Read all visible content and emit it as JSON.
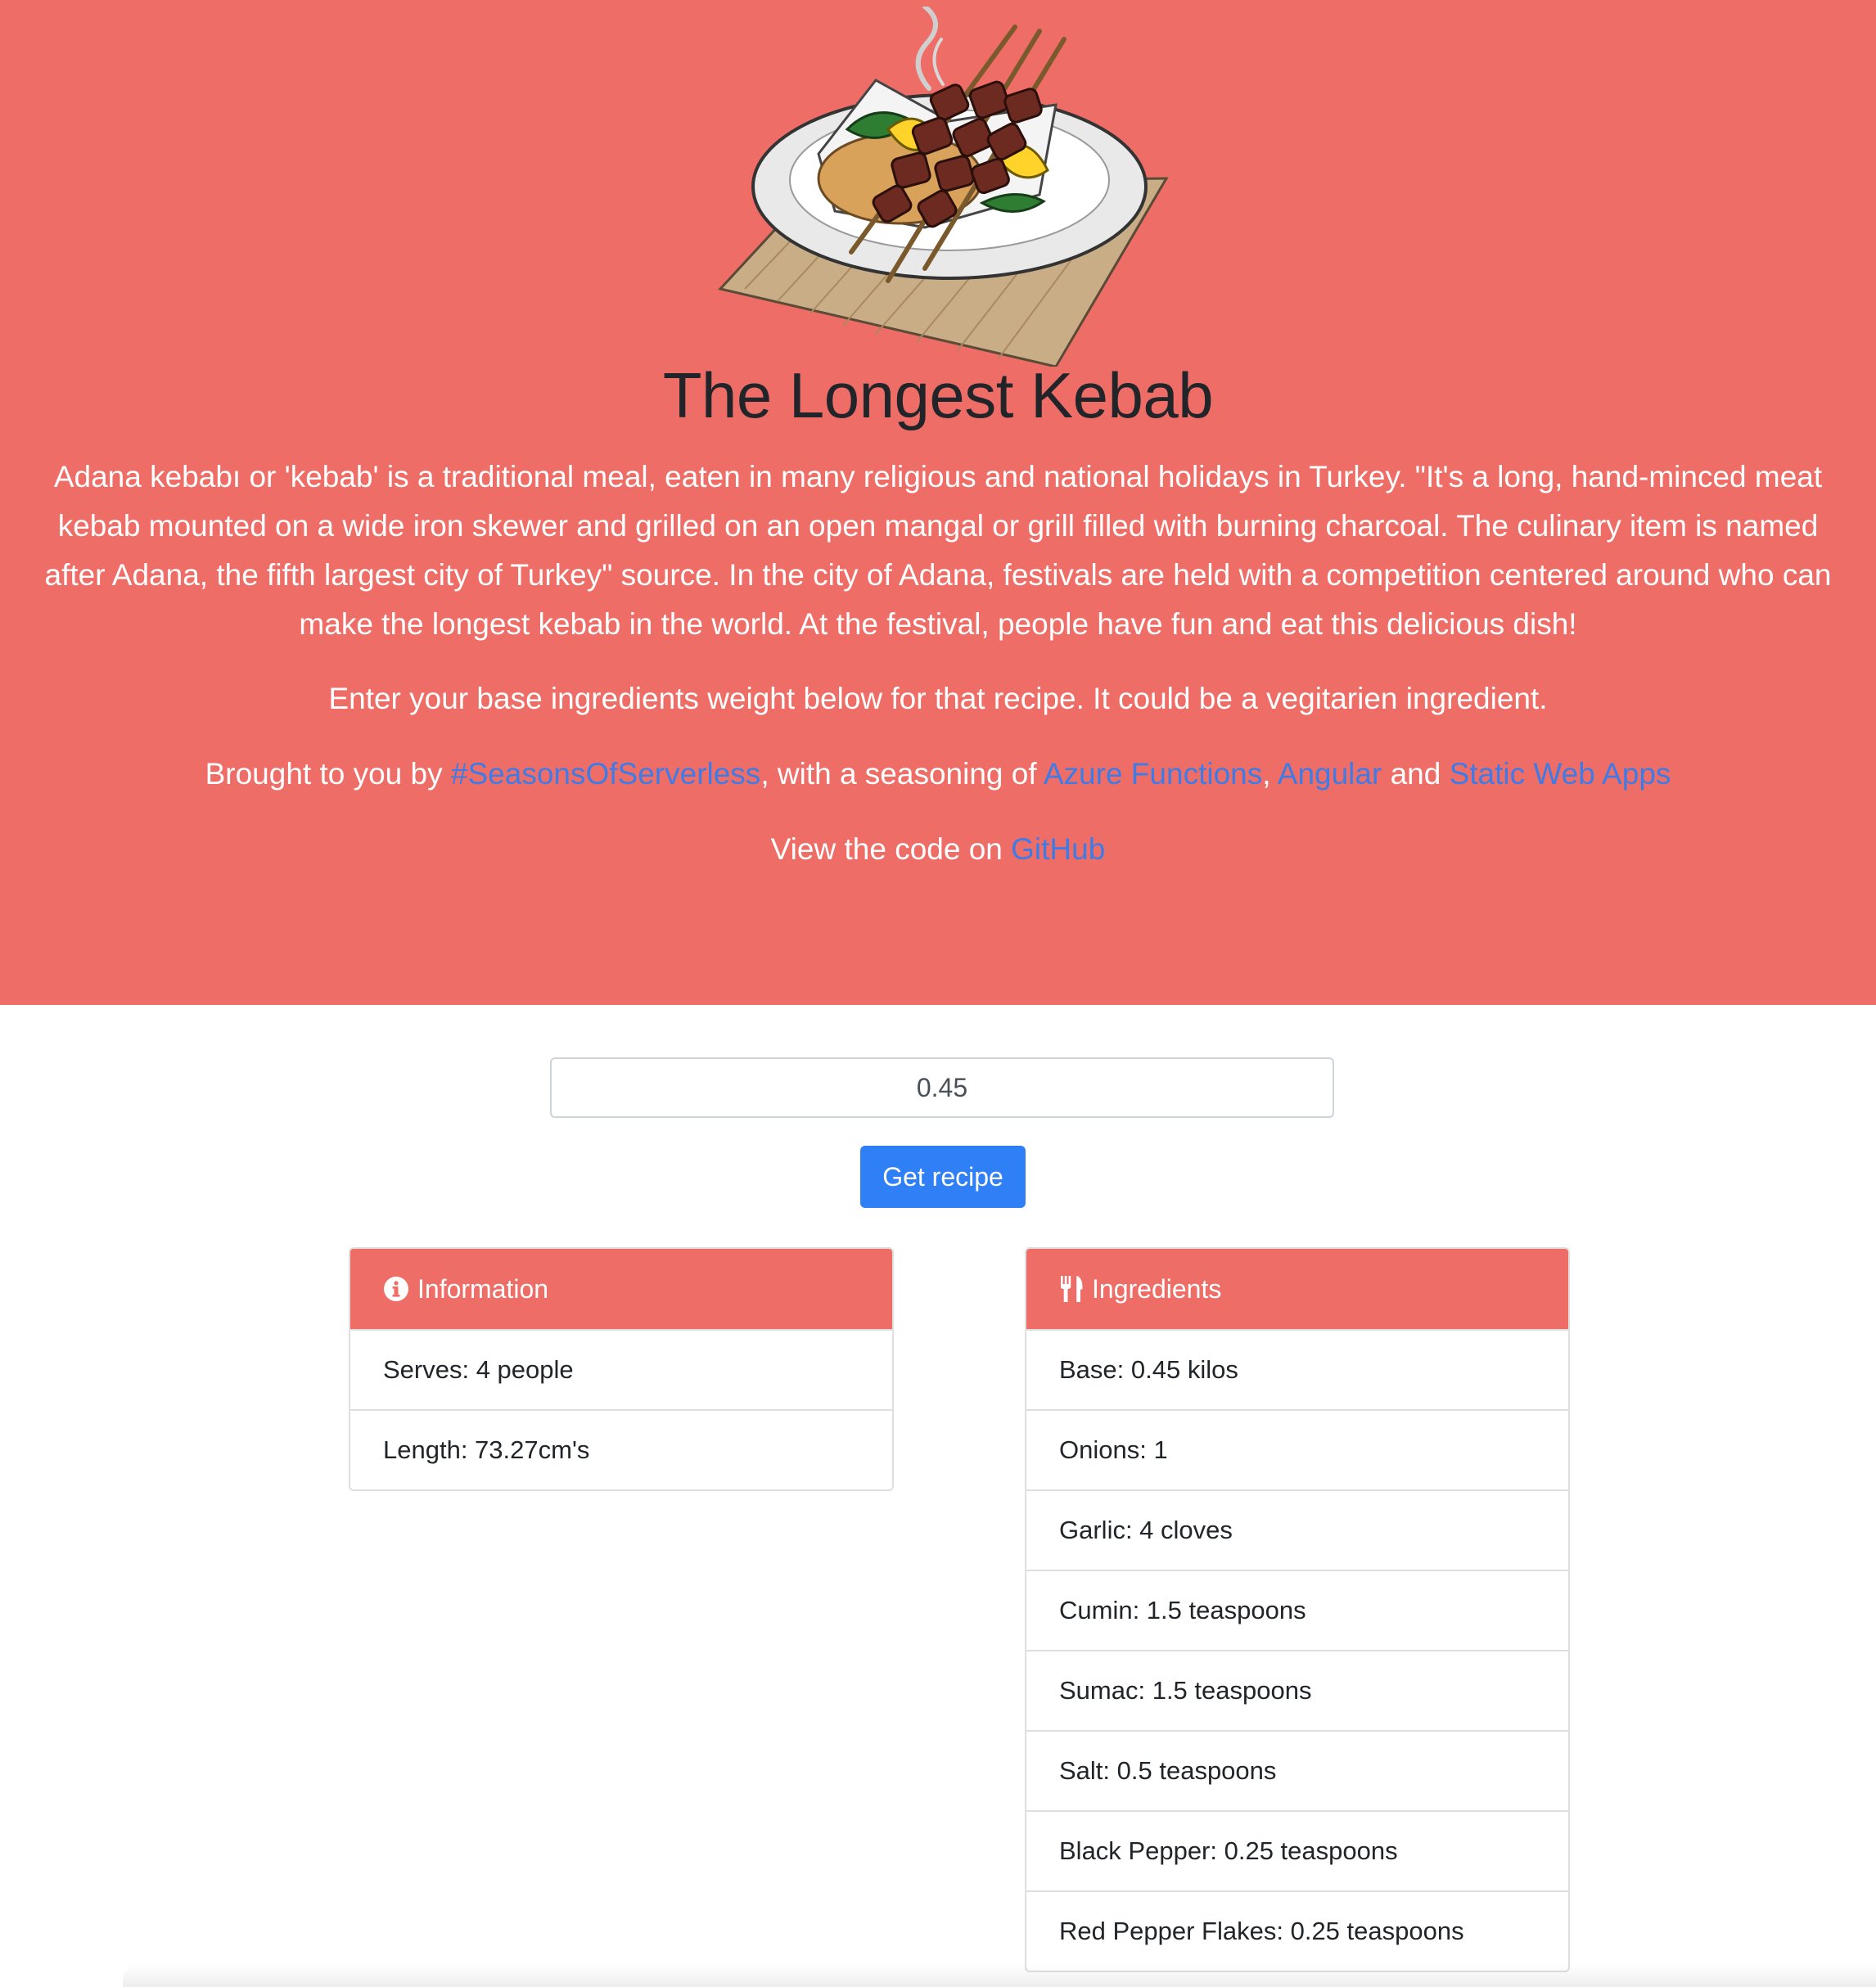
{
  "hero": {
    "title": "The Longest Kebab",
    "intro": "Adana kebabı or 'kebab' is a traditional meal, eaten in many religious and national holidays in Turkey. \"It's a long, hand-minced meat kebab mounted on a wide iron skewer and grilled on an open mangal or grill filled with burning charcoal. The culinary item is named after Adana, the fifth largest city of Turkey\" source. In the city of Adana, festivals are held with a competition centered around who can make the longest kebab in the world. At the festival, people have fun and eat this delicious dish!",
    "instruction": "Enter your base ingredients weight below for that recipe. It could be a vegitarien ingredient.",
    "credits": {
      "prefix": "Brought to you by ",
      "link_serverless": "#SeasonsOfServerless",
      "middle": ", with a seasoning of ",
      "link_functions": "Azure Functions",
      "comma": ", ",
      "link_angular": "Angular",
      "and": " and ",
      "link_swa": "Static Web Apps"
    },
    "code": {
      "prefix": "View the code on ",
      "link_github": "GitHub"
    }
  },
  "form": {
    "weight_value": "0.45",
    "button_label": "Get recipe"
  },
  "information": {
    "title": "Information",
    "icon": "info-circle-icon",
    "items": [
      "Serves: 4 people",
      "Length: 73.27cm's"
    ]
  },
  "ingredients": {
    "title": "Ingredients",
    "icon": "utensils-icon",
    "items": [
      "Base: 0.45 kilos",
      "Onions: 1",
      "Garlic: 4 cloves",
      "Cumin: 1.5 teaspoons",
      "Sumac: 1.5 teaspoons",
      "Salt: 0.5 teaspoons",
      "Black Pepper: 0.25 teaspoons",
      "Red Pepper Flakes: 0.25 teaspoons"
    ]
  },
  "colors": {
    "hero_background": "#ee6e67",
    "link": "#3e7be6",
    "button": "#2f7ff6",
    "card_header": "#ee6e67"
  }
}
